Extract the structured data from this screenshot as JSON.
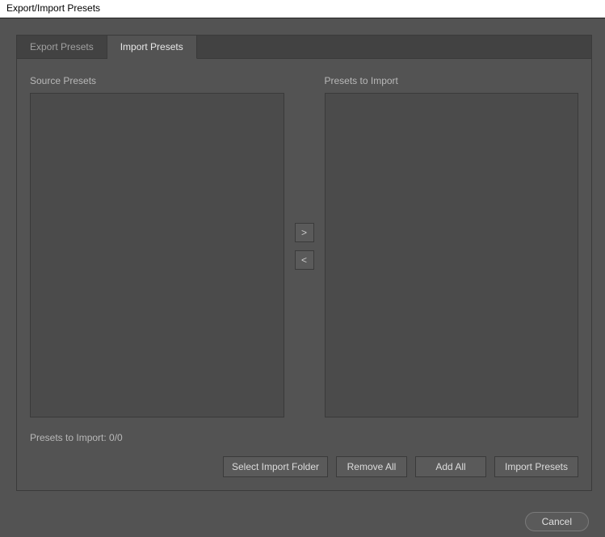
{
  "window": {
    "title": "Export/Import Presets"
  },
  "tabs": {
    "export": {
      "label": "Export Presets"
    },
    "import": {
      "label": "Import Presets"
    }
  },
  "labels": {
    "source": "Source Presets",
    "target": "Presets to Import"
  },
  "arrows": {
    "right": ">",
    "left": "<"
  },
  "status": {
    "text": "Presets to Import: 0/0"
  },
  "buttons": {
    "select_folder": "Select Import Folder",
    "remove_all": "Remove All",
    "add_all": "Add All",
    "import_presets": "Import Presets",
    "cancel": "Cancel"
  }
}
